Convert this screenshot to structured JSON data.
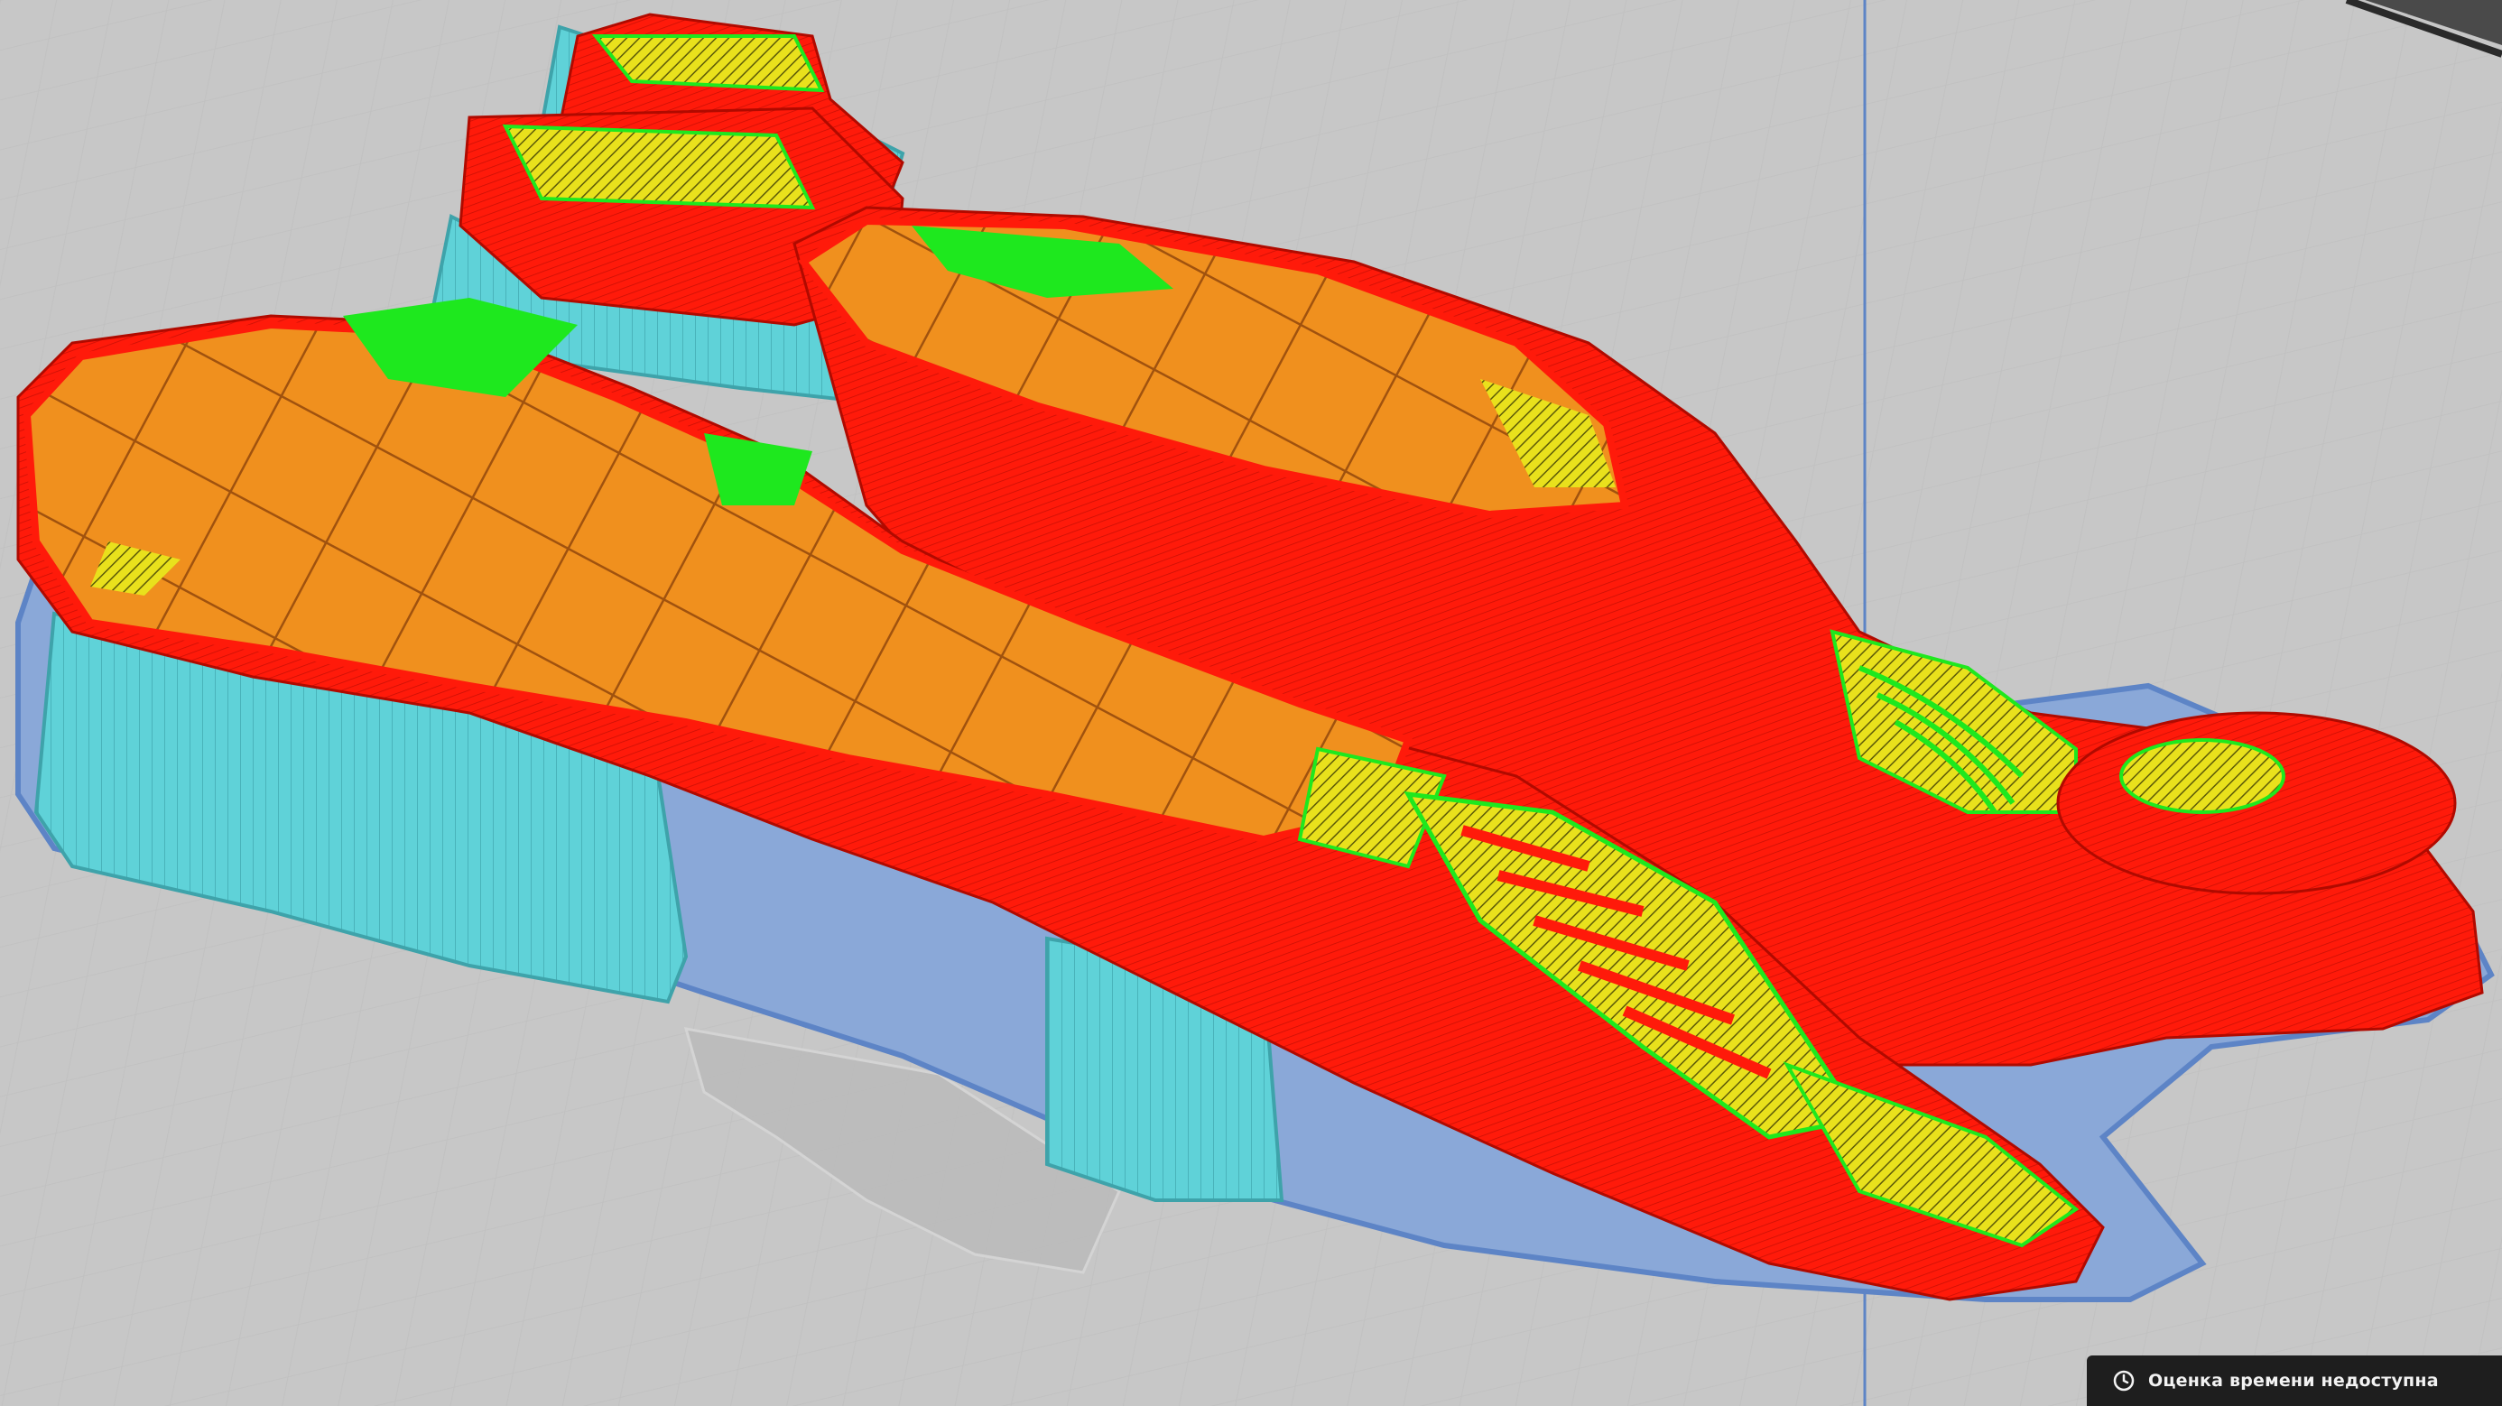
{
  "status": {
    "icon": "clock-icon",
    "time_estimate_text": "Оценка времени недоступна"
  },
  "colors": {
    "background": "#c7c7c7",
    "grid_lines": "#b8b8b8",
    "build_plate_edge": "#5d84c6",
    "perimeter": "#ff1a0a",
    "infill": "#f0901e",
    "solid_infill": "#e9e11c",
    "top_surface": "#1ee81e",
    "support": "#5fd2d8",
    "support_interface": "#8aa8d8",
    "status_bar": "#1e1e1e"
  }
}
